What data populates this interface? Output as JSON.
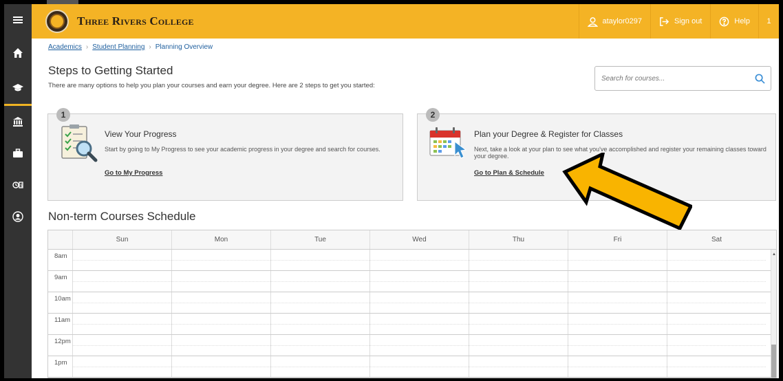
{
  "header": {
    "college_name": "Three Rivers College",
    "username": "ataylor0297",
    "signout_label": "Sign out",
    "help_label": "Help",
    "notification_count": "1"
  },
  "sidebar": {
    "items": [
      "menu-icon",
      "home-icon",
      "graduation-cap-icon",
      "bank-icon",
      "briefcase-icon",
      "finance-icon",
      "user-icon"
    ]
  },
  "breadcrumb": {
    "items": [
      "Academics",
      "Student Planning",
      "Planning Overview"
    ]
  },
  "steps": {
    "title": "Steps to Getting Started",
    "subtitle": "There are many options to help you plan your courses and earn your degree. Here are 2 steps to get you started:",
    "search_placeholder": "Search for courses...",
    "cards": [
      {
        "number": "1",
        "title": "View Your Progress",
        "text": "Start by going to My Progress to see your academic progress in your degree and search for courses.",
        "link": "Go to My Progress"
      },
      {
        "number": "2",
        "title": "Plan your Degree & Register for Classes",
        "text": "Next, take a look at your plan to see what you've accomplished and register your remaining classes toward your degree.",
        "link": "Go to Plan & Schedule"
      }
    ]
  },
  "schedule": {
    "title": "Non-term Courses Schedule",
    "days": [
      "Sun",
      "Mon",
      "Tue",
      "Wed",
      "Thu",
      "Fri",
      "Sat"
    ],
    "hours": [
      "8am",
      "9am",
      "10am",
      "11am",
      "12pm",
      "1pm"
    ]
  },
  "colors": {
    "header_bg": "#f4b325",
    "sidebar_bg": "#333333",
    "link": "#1f5f9e",
    "arrow_fill": "#f9b400"
  }
}
